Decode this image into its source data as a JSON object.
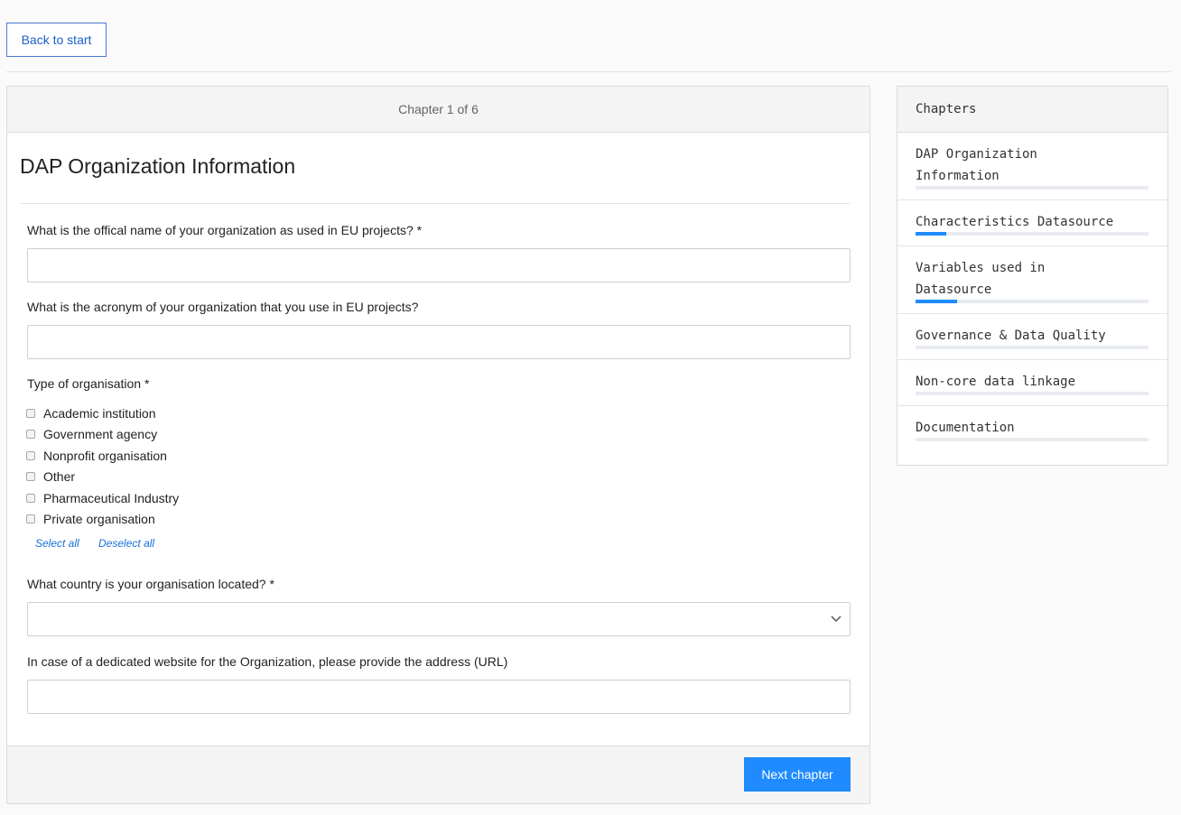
{
  "back_button": "Back to start",
  "progress_header": "Chapter 1 of 6",
  "chapter": {
    "title": "DAP Organization Information",
    "questions": {
      "official_name": {
        "label": "What is the offical name of your organization as used in EU projects? *",
        "value": ""
      },
      "acronym": {
        "label": "What is the acronym of your organization that you use in EU projects?",
        "value": ""
      },
      "org_type": {
        "label": "Type of organisation *",
        "options": [
          "Academic institution",
          "Government agency",
          "Nonprofit organisation",
          "Other",
          "Pharmaceutical Industry",
          "Private organisation"
        ],
        "select_all": "Select all",
        "deselect_all": "Deselect all"
      },
      "country": {
        "label": "What country is your organisation located? *",
        "value": ""
      },
      "website": {
        "label": "In case of a dedicated website for the Organization, please provide the address (URL)",
        "value": ""
      }
    }
  },
  "next_button": "Next chapter",
  "sidebar": {
    "title": "Chapters",
    "items": [
      {
        "label": "DAP Organization Information",
        "progress": 0
      },
      {
        "label": "Characteristics Datasource",
        "progress": 0.13
      },
      {
        "label": "Variables used in Datasource",
        "progress": 0.18
      },
      {
        "label": "Governance & Data Quality",
        "progress": 0
      },
      {
        "label": "Non-core data linkage",
        "progress": 0
      },
      {
        "label": "Documentation",
        "progress": 0
      }
    ]
  },
  "colors": {
    "accent": "#1f8bff",
    "link": "#1a6fd6"
  }
}
